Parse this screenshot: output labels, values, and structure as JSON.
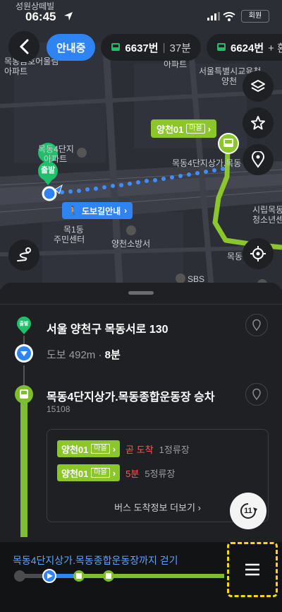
{
  "status": {
    "time": "06:45",
    "battery": "회원",
    "carrier_label": "성원상떼빌"
  },
  "header": {
    "back_label": "<",
    "chips": [
      {
        "label": "안내중",
        "active": true
      },
      {
        "num": "6637번",
        "sub": "37분"
      },
      {
        "num": "6624번",
        "sub": "+ 환"
      }
    ]
  },
  "map": {
    "labels": [
      "성원상떼빌",
      "목동금호어울림",
      "아파트",
      "아파트",
      "서울특별시교육청",
      "양천",
      "목동4단지",
      "아파트",
      "목동4단지상가.목동",
      "목1동",
      "주민센터",
      "양천소방서",
      "시립목동",
      "청소년센",
      "목동",
      "SBS"
    ],
    "start_label": "출발",
    "walk_badge": "도보길안내",
    "bus_badge": {
      "route": "양천01",
      "tag": "마을"
    }
  },
  "sheet": {
    "origin": {
      "badge": "출발",
      "address": "서울 양천구 목동서로 130"
    },
    "walk": {
      "mode": "도보",
      "distance": "492m",
      "sep": "·",
      "time": "8분"
    },
    "stop": {
      "name": "목동4단지상가.목동종합운동장 승차",
      "code": "15108"
    },
    "arrivals": [
      {
        "route": "양천01",
        "tag": "마을",
        "status": "곧 도착",
        "stops": "1정류장"
      },
      {
        "route": "양천01",
        "tag": "마을",
        "status": "5분",
        "stops": "5정류장"
      }
    ],
    "more": "버스 도착정보 더보기 ›",
    "refresh_label": "11"
  },
  "bottom": {
    "title": "목동4단지상가.목동종합운동장까지 걷기"
  },
  "colors": {
    "accent_blue": "#2f84f4",
    "bus_green": "#8bc62b",
    "highlight": "#f5d90a",
    "red": "#ff5a4e"
  }
}
